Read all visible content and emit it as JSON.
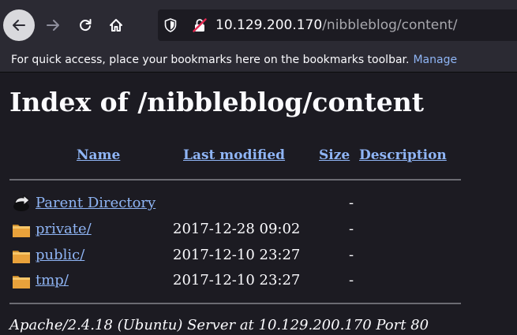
{
  "toolbar": {
    "back_icon": "arrow-left-icon",
    "forward_icon": "arrow-right-icon",
    "reload_icon": "reload-icon",
    "home_icon": "home-icon"
  },
  "urlbar": {
    "shield_icon": "shield-icon",
    "lock_icon": "insecure-lock-icon",
    "host": "10.129.200.170",
    "path": "/nibbleblog/content/"
  },
  "bookmarks_bar": {
    "text": "For quick access, place your bookmarks here on the bookmarks toolbar.",
    "link": "Manage"
  },
  "page": {
    "title": "Index of /nibbleblog/content",
    "columns": {
      "name": "Name",
      "last_modified": "Last modified",
      "size": "Size",
      "description": "Description"
    },
    "rows": [
      {
        "icon": "back-arrow-icon",
        "name": "Parent Directory",
        "modified": "",
        "size": "-"
      },
      {
        "icon": "folder-icon",
        "name": "private/",
        "modified": "2017-12-28 09:02",
        "size": "-"
      },
      {
        "icon": "folder-icon",
        "name": "public/",
        "modified": "2017-12-10 23:27",
        "size": "-"
      },
      {
        "icon": "folder-icon",
        "name": "tmp/",
        "modified": "2017-12-10 23:27",
        "size": "-"
      }
    ],
    "server_signature": "Apache/2.4.18 (Ubuntu) Server at 10.129.200.170 Port 80"
  },
  "colors": {
    "chrome_bg": "#2b2a33",
    "page_bg": "#1c1b22",
    "link": "#8fb5f5",
    "text": "#fbfbfe"
  }
}
